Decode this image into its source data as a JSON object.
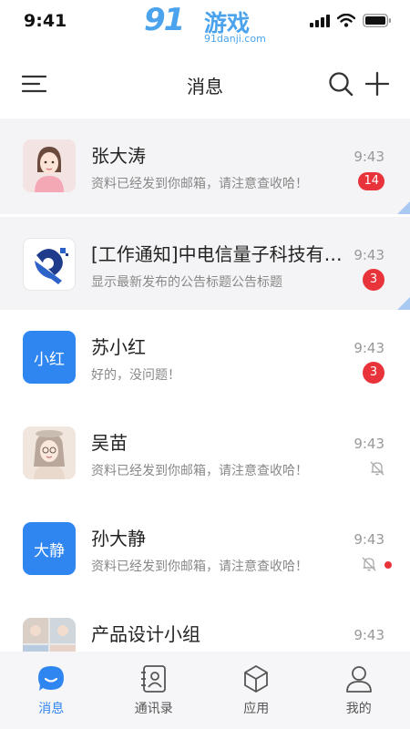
{
  "status_bar": {
    "time": "9:41"
  },
  "watermark": {
    "brand_big": "91",
    "brand_cn": "游戏",
    "url": "91danji.com"
  },
  "header": {
    "title": "消息"
  },
  "conversations": [
    {
      "name": "张大涛",
      "message": "资料已经发到你邮箱，请注意查收哈！",
      "time": "9:43",
      "badge": "14",
      "avatar": "photo-woman",
      "pinned": true
    },
    {
      "name": "[工作通知]中电信量子科技有限公司",
      "message": "显示最新发布的公告标题公告标题",
      "time": "9:43",
      "badge": "3",
      "avatar": "company-logo",
      "pinned": true
    },
    {
      "name": "苏小红",
      "message": "好的，没问题！",
      "time": "9:43",
      "badge": "3",
      "avatar_text": "小红"
    },
    {
      "name": "吴苗",
      "message": "资料已经发到你邮箱，请注意查收哈！",
      "time": "9:43",
      "muted": true,
      "avatar": "photo-girl"
    },
    {
      "name": "孙大静",
      "message": "资料已经发到你邮箱，请注意查收哈！",
      "time": "9:43",
      "muted": true,
      "unread_dot": true,
      "avatar_text": "大静"
    },
    {
      "name": "产品设计小组",
      "message": "",
      "time": "9:43",
      "avatar": "group-photos"
    }
  ],
  "tabs": [
    {
      "label": "消息",
      "icon": "chat-bubble-icon",
      "active": true
    },
    {
      "label": "通讯录",
      "icon": "contacts-icon"
    },
    {
      "label": "应用",
      "icon": "cube-icon"
    },
    {
      "label": "我的",
      "icon": "person-icon"
    }
  ],
  "colors": {
    "accent": "#2f86f0",
    "badge": "#e8333a",
    "pinned_bg": "#f4f4f6",
    "watermark": "#4aa3ec"
  }
}
